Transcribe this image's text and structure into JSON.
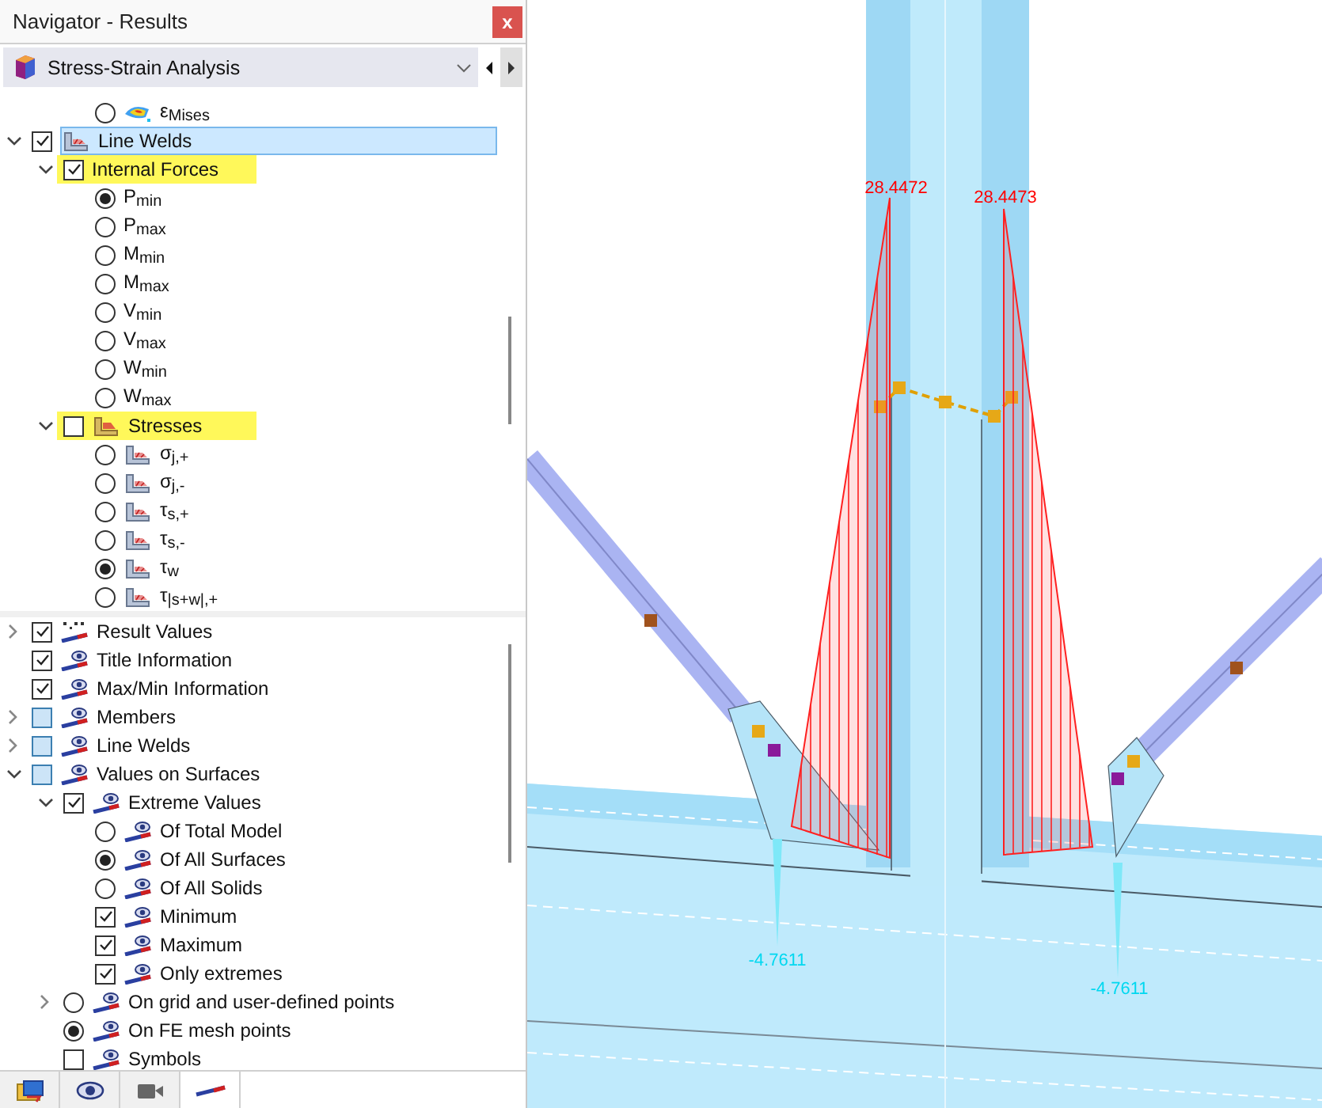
{
  "window": {
    "title": "Navigator - Results",
    "close": "x"
  },
  "module_selector": {
    "label": "Stress-Strain Analysis"
  },
  "upper_tree": {
    "first_visible_row": {
      "kind": "radio",
      "label": "ε$_{Mises}$",
      "selected": false
    },
    "items": [
      {
        "kind": "checkbox",
        "label": "Line Welds",
        "checked": true,
        "expanded": true,
        "highlighted": false,
        "selected": true,
        "children": [
          {
            "kind": "checkbox",
            "label": "Internal Forces",
            "checked": true,
            "expanded": true,
            "highlighted": true,
            "selected": false,
            "children": [
              {
                "kind": "radio",
                "label": "P$_{min}$",
                "selected": true
              },
              {
                "kind": "radio",
                "label": "P$_{max}$",
                "selected": false
              },
              {
                "kind": "radio",
                "label": "M$_{min}$",
                "selected": false
              },
              {
                "kind": "radio",
                "label": "M$_{max}$",
                "selected": false
              },
              {
                "kind": "radio",
                "label": "V$_{min}$",
                "selected": false
              },
              {
                "kind": "radio",
                "label": "V$_{max}$",
                "selected": false
              },
              {
                "kind": "radio",
                "label": "W$_{min}$",
                "selected": false
              },
              {
                "kind": "radio",
                "label": "W$_{max}$",
                "selected": false
              }
            ]
          },
          {
            "kind": "checkbox",
            "label": "Stresses",
            "checked": false,
            "expanded": true,
            "highlighted": true,
            "selected": false,
            "children": [
              {
                "kind": "radio",
                "label": "σ$_{j,+}$",
                "selected": false
              },
              {
                "kind": "radio",
                "label": "σ$_{j,-}$",
                "selected": false
              },
              {
                "kind": "radio",
                "label": "τ$_{s,+}$",
                "selected": false
              },
              {
                "kind": "radio",
                "label": "τ$_{s,-}$",
                "selected": false
              },
              {
                "kind": "radio",
                "label": "τ$_{w}$",
                "selected": true
              },
              {
                "kind": "radio",
                "label": "τ$_{|s+w|,+}$",
                "selected": false
              }
            ]
          }
        ]
      }
    ]
  },
  "lower_tree": {
    "items": [
      {
        "kind": "checkbox",
        "label": "Result Values",
        "checked": true,
        "indeterminate": false,
        "expanded": false
      },
      {
        "kind": "checkbox",
        "label": "Title Information",
        "checked": true,
        "indeterminate": false
      },
      {
        "kind": "checkbox",
        "label": "Max/Min Information",
        "checked": true,
        "indeterminate": false
      },
      {
        "kind": "checkbox",
        "label": "Members",
        "checked": false,
        "indeterminate": true,
        "expanded": false
      },
      {
        "kind": "checkbox",
        "label": "Line Welds",
        "checked": false,
        "indeterminate": true,
        "expanded": false
      },
      {
        "kind": "checkbox",
        "label": "Values on Surfaces",
        "checked": false,
        "indeterminate": true,
        "expanded": true,
        "children": [
          {
            "kind": "checkbox",
            "label": "Extreme Values",
            "checked": true,
            "indeterminate": false,
            "expanded": true,
            "children": [
              {
                "kind": "radio",
                "label": "Of Total Model",
                "selected": false
              },
              {
                "kind": "radio",
                "label": "Of All Surfaces",
                "selected": true
              },
              {
                "kind": "radio",
                "label": "Of All Solids",
                "selected": false
              },
              {
                "kind": "checkbox",
                "label": "Minimum",
                "checked": true,
                "indeterminate": false
              },
              {
                "kind": "checkbox",
                "label": "Maximum",
                "checked": true,
                "indeterminate": false
              },
              {
                "kind": "checkbox",
                "label": "Only extremes",
                "checked": true,
                "indeterminate": false
              }
            ]
          },
          {
            "kind": "radio",
            "label": "On grid and user-defined points",
            "selected": false,
            "expanded": false
          },
          {
            "kind": "radio",
            "label": "On FE mesh points",
            "selected": true
          },
          {
            "kind": "checkbox",
            "label": "Symbols",
            "checked": false,
            "indeterminate": false
          }
        ]
      }
    ]
  },
  "bottom_tabs": [
    {
      "kind": "data",
      "selected": false
    },
    {
      "kind": "display",
      "selected": false
    },
    {
      "kind": "views",
      "selected": false
    },
    {
      "kind": "results",
      "selected": true
    }
  ],
  "view": {
    "labels": [
      {
        "kind": "max",
        "text": "28.4472"
      },
      {
        "kind": "max",
        "text": "28.4473"
      },
      {
        "kind": "min",
        "text": "-4.7611"
      },
      {
        "kind": "min",
        "text": "-4.7611"
      }
    ]
  }
}
